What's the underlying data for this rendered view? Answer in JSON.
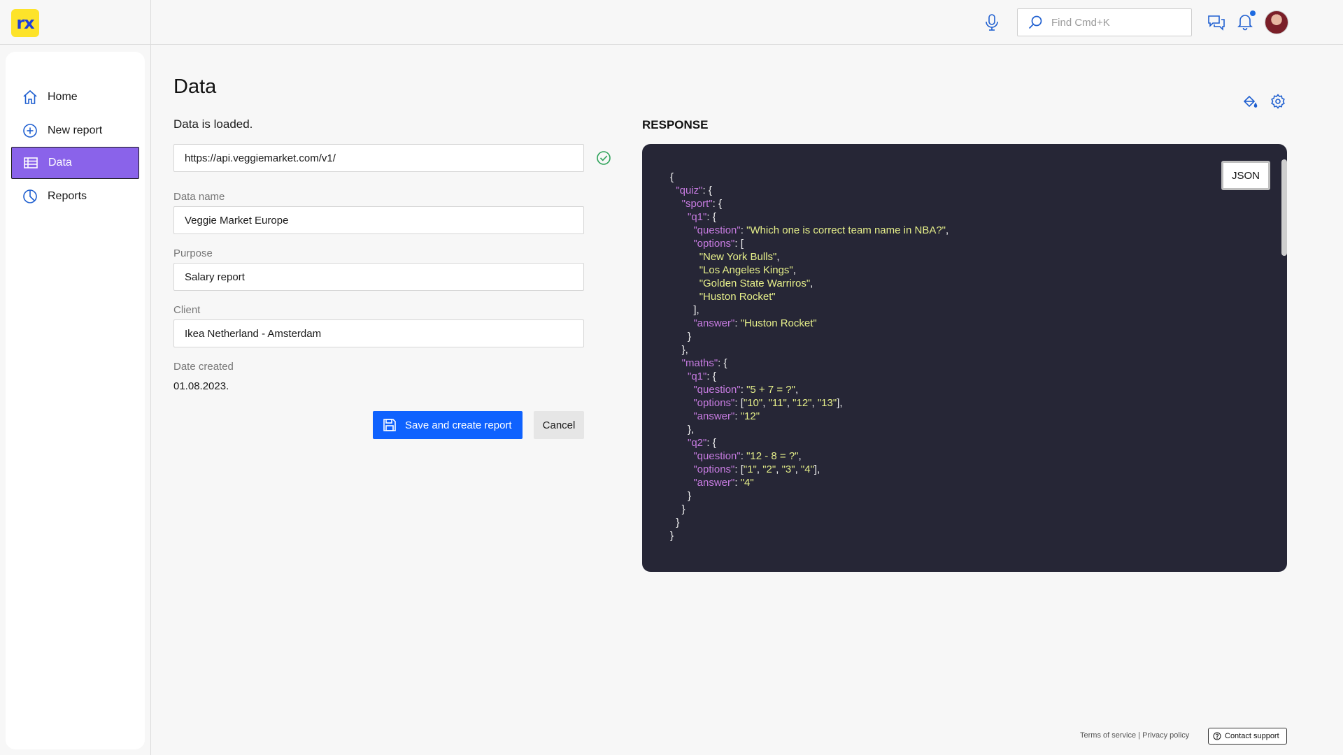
{
  "header": {
    "logo_text": "rx",
    "search_placeholder": "Find Cmd+K",
    "icons": [
      "microphone-icon",
      "search-icon",
      "chat-icon",
      "bell-icon"
    ],
    "notification_dot_color": "#1f6be0"
  },
  "sidebar": {
    "items": [
      {
        "label": "Home",
        "icon": "home-icon"
      },
      {
        "label": "New report",
        "icon": "plus-circle-icon"
      },
      {
        "label": "Data",
        "icon": "table-icon",
        "active": true
      },
      {
        "label": "Reports",
        "icon": "pie-chart-icon"
      }
    ],
    "active_color": "#8a63ea"
  },
  "main": {
    "title": "Data",
    "status": "Data is loaded.",
    "url_value": "https://api.veggiemarket.com/v1/",
    "fields": {
      "data_name_label": "Data name",
      "data_name_value": "Veggie Market Europe",
      "purpose_label": "Purpose",
      "purpose_value": "Salary report",
      "client_label": "Client",
      "client_value": "Ikea Netherland - Amsterdam",
      "date_label": "Date created",
      "date_value": "01.08.2023."
    },
    "save_label": "Save and create report",
    "cancel_label": "Cancel",
    "primary_color": "#0f62fe"
  },
  "response": {
    "title": "RESPONSE",
    "format_label": "JSON",
    "code_lines": [
      [
        [
          "p",
          "{"
        ]
      ],
      [
        [
          "p",
          "  "
        ],
        [
          "k",
          "\"quiz\""
        ],
        [
          "p",
          ": {"
        ]
      ],
      [
        [
          "p",
          "    "
        ],
        [
          "k",
          "\"sport\""
        ],
        [
          "p",
          ": {"
        ]
      ],
      [
        [
          "p",
          "      "
        ],
        [
          "k",
          "\"q1\""
        ],
        [
          "p",
          ": {"
        ]
      ],
      [
        [
          "p",
          "        "
        ],
        [
          "k",
          "\"question\""
        ],
        [
          "p",
          ": "
        ],
        [
          "s",
          "\"Which one is correct team name in NBA?\""
        ],
        [
          "p",
          ","
        ]
      ],
      [
        [
          "p",
          "        "
        ],
        [
          "k",
          "\"options\""
        ],
        [
          "p",
          ": ["
        ]
      ],
      [
        [
          "p",
          "          "
        ],
        [
          "s",
          "\"New York Bulls\""
        ],
        [
          "p",
          ","
        ]
      ],
      [
        [
          "p",
          "          "
        ],
        [
          "s",
          "\"Los Angeles Kings\""
        ],
        [
          "p",
          ","
        ]
      ],
      [
        [
          "p",
          "          "
        ],
        [
          "s",
          "\"Golden State Warriros\""
        ],
        [
          "p",
          ","
        ]
      ],
      [
        [
          "p",
          "          "
        ],
        [
          "s",
          "\"Huston Rocket\""
        ]
      ],
      [
        [
          "p",
          "        ],"
        ]
      ],
      [
        [
          "p",
          "        "
        ],
        [
          "k",
          "\"answer\""
        ],
        [
          "p",
          ": "
        ],
        [
          "s",
          "\"Huston Rocket\""
        ]
      ],
      [
        [
          "p",
          "      }"
        ]
      ],
      [
        [
          "p",
          "    },"
        ]
      ],
      [
        [
          "p",
          "    "
        ],
        [
          "k",
          "\"maths\""
        ],
        [
          "p",
          ": {"
        ]
      ],
      [
        [
          "p",
          "      "
        ],
        [
          "k",
          "\"q1\""
        ],
        [
          "p",
          ": {"
        ]
      ],
      [
        [
          "p",
          "        "
        ],
        [
          "k",
          "\"question\""
        ],
        [
          "p",
          ": "
        ],
        [
          "s",
          "\"5 + 7 = ?\""
        ],
        [
          "p",
          ","
        ]
      ],
      [
        [
          "p",
          "        "
        ],
        [
          "k",
          "\"options\""
        ],
        [
          "p",
          ": ["
        ],
        [
          "s",
          "\"10\""
        ],
        [
          "p",
          ", "
        ],
        [
          "s",
          "\"11\""
        ],
        [
          "p",
          ", "
        ],
        [
          "s",
          "\"12\""
        ],
        [
          "p",
          ", "
        ],
        [
          "s",
          "\"13\""
        ],
        [
          "p",
          "],"
        ]
      ],
      [
        [
          "p",
          "        "
        ],
        [
          "k",
          "\"answer\""
        ],
        [
          "p",
          ": "
        ],
        [
          "s",
          "\"12\""
        ]
      ],
      [
        [
          "p",
          "      },"
        ]
      ],
      [
        [
          "p",
          "      "
        ],
        [
          "k",
          "\"q2\""
        ],
        [
          "p",
          ": {"
        ]
      ],
      [
        [
          "p",
          "        "
        ],
        [
          "k",
          "\"question\""
        ],
        [
          "p",
          ": "
        ],
        [
          "s",
          "\"12 - 8 = ?\""
        ],
        [
          "p",
          ","
        ]
      ],
      [
        [
          "p",
          "        "
        ],
        [
          "k",
          "\"options\""
        ],
        [
          "p",
          ": ["
        ],
        [
          "s",
          "\"1\""
        ],
        [
          "p",
          ", "
        ],
        [
          "s",
          "\"2\""
        ],
        [
          "p",
          ", "
        ],
        [
          "s",
          "\"3\""
        ],
        [
          "p",
          ", "
        ],
        [
          "s",
          "\"4\""
        ],
        [
          "p",
          "],"
        ]
      ],
      [
        [
          "p",
          "        "
        ],
        [
          "k",
          "\"answer\""
        ],
        [
          "p",
          ": "
        ],
        [
          "s",
          "\"4\""
        ]
      ],
      [
        [
          "p",
          "      }"
        ]
      ],
      [
        [
          "p",
          "    }"
        ]
      ],
      [
        [
          "p",
          "  }"
        ]
      ],
      [
        [
          "p",
          "}"
        ]
      ]
    ],
    "key_color": "#c67be0",
    "string_color": "#e6ef8a",
    "panel_color": "#262636"
  },
  "footer": {
    "terms": "Terms of service",
    "separator": " | ",
    "privacy": "Privacy policy",
    "support_label": "Contact support"
  }
}
